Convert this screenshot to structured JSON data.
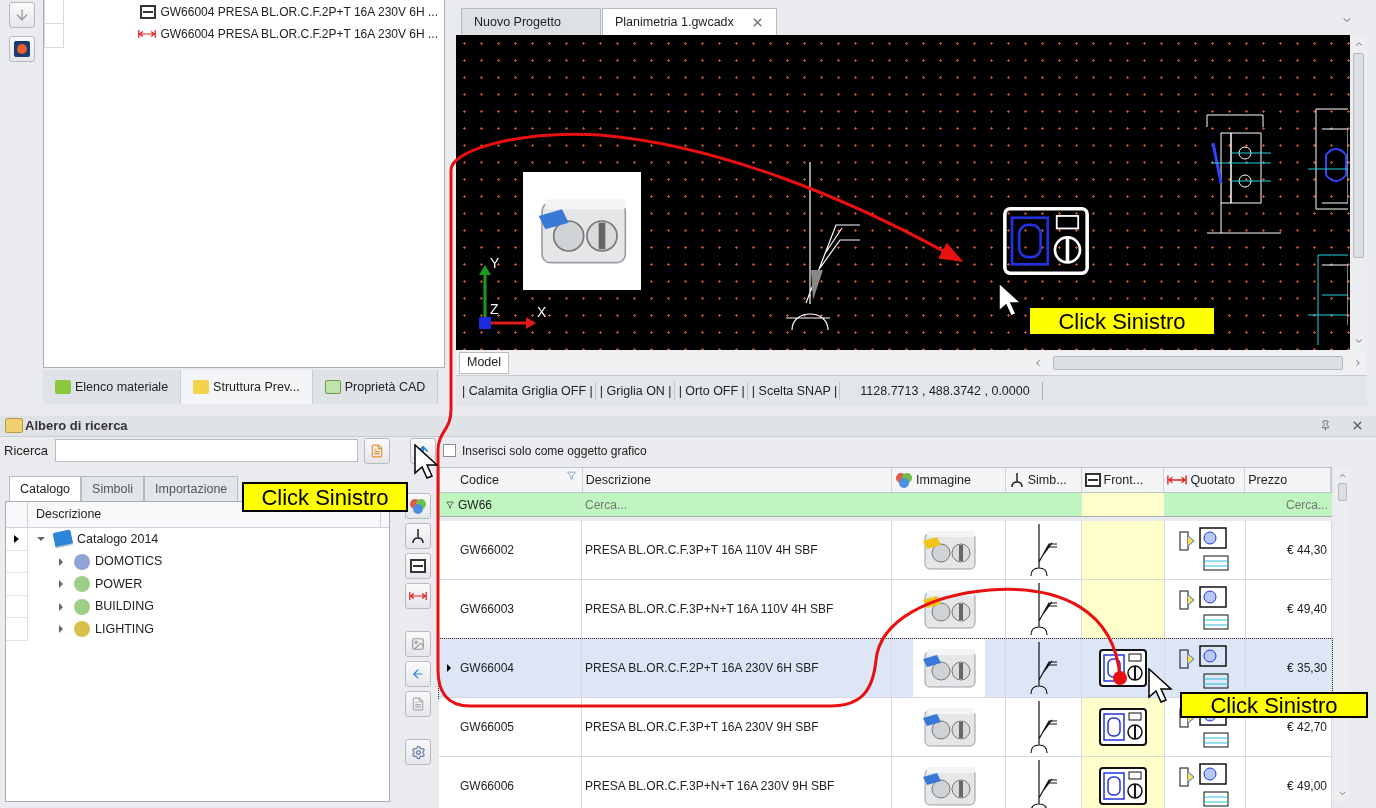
{
  "material_list": {
    "items": [
      {
        "kind": "front",
        "text": "GW66004 PRESA BL.OR.C.F.2P+T 16A 230V 6H ..."
      },
      {
        "kind": "dimensioned",
        "text": "GW66004 PRESA BL.OR.C.F.2P+T 16A 230V 6H ..."
      }
    ]
  },
  "panel_tabs": [
    {
      "label": "Elenco materiale",
      "selected": false
    },
    {
      "label": "Struttura Prev...",
      "selected": true
    },
    {
      "label": "Proprietà CAD",
      "selected": false
    }
  ],
  "document_tabs": [
    {
      "label": "Nuovo Progetto",
      "selected": false
    },
    {
      "label": "Planimetria 1.gwcadx",
      "selected": true
    }
  ],
  "canvas": {
    "axis_labels": [
      "Y",
      "Z",
      "X"
    ],
    "layout_tab": "Model"
  },
  "status_bar": [
    "| Calamita Griglia OFF |",
    "| Griglia ON |",
    "| Orto OFF |",
    "| Scelta SNAP |",
    "1128.7713 , 488.3742 , 0.0000"
  ],
  "search_panel": {
    "title": "Albero di ricerca",
    "search_label": "Ricerca",
    "graphic_only": {
      "label": "Inserisci solo come oggetto grafico",
      "checked": false
    }
  },
  "catalog_tabs": [
    {
      "label": "Catalogo",
      "selected": true
    },
    {
      "label": "Simboli",
      "selected": false
    },
    {
      "label": "Importazione",
      "selected": false
    }
  ],
  "tree": {
    "column": "Descrizione",
    "items": [
      {
        "label": "Catalogo 2014",
        "expanded": true,
        "children": [
          {
            "label": "DOMOTICS",
            "expanded": false,
            "color": "#8fa3d6"
          },
          {
            "label": "POWER",
            "expanded": false,
            "color": "#9fcf86"
          },
          {
            "label": "BUILDING",
            "expanded": false,
            "color": "#9fcf86"
          },
          {
            "label": "LIGHTING",
            "expanded": false,
            "color": "#d9c04a"
          }
        ]
      }
    ]
  },
  "table": {
    "columns": [
      {
        "kind": "code",
        "label": "Codice"
      },
      {
        "kind": "text",
        "label": "Descrizione"
      },
      {
        "kind": "image",
        "label": "Immagine"
      },
      {
        "kind": "symbol",
        "label": "Simb..."
      },
      {
        "kind": "front",
        "label": "Front..."
      },
      {
        "kind": "dimensioned",
        "label": "Quotato"
      },
      {
        "kind": "price",
        "label": "Prezzo"
      }
    ],
    "filter": {
      "code": "GW66",
      "description_placeholder": "Cerca...",
      "price_placeholder": "Cerca..."
    },
    "rows": [
      {
        "code": "GW66002",
        "description": "PRESA BL.OR.C.F.3P+T 16A 110V 4H SBF",
        "price": "€ 44,30",
        "selected": false,
        "front_view": false
      },
      {
        "code": "GW66003",
        "description": "PRESA BL.OR.C.F.3P+N+T 16A 110V 4H SBF",
        "price": "€ 49,40",
        "selected": false,
        "front_view": false
      },
      {
        "code": "GW66004",
        "description": "PRESA BL.OR.C.F.2P+T 16A 230V 6H SBF",
        "price": "€ 35,30",
        "selected": true,
        "front_view": true
      },
      {
        "code": "GW66005",
        "description": "PRESA BL.OR.C.F.3P+T 16A 230V 9H SBF",
        "price": "€ 42,70",
        "selected": false,
        "front_view": true
      },
      {
        "code": "GW66006",
        "description": "PRESA BL.OR.C.F.3P+N+T 16A 230V 9H SBF",
        "price": "€ 49,00",
        "selected": false,
        "front_view": true
      }
    ]
  },
  "callouts": [
    {
      "text": "Click Sinistro"
    },
    {
      "text": "Click Sinistro"
    },
    {
      "text": "Click Sinistro"
    }
  ]
}
